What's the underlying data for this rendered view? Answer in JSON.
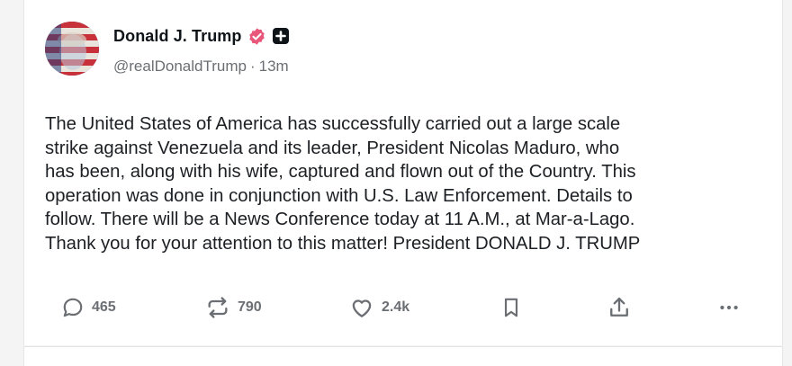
{
  "post": {
    "author_name": "Donald J. Trump",
    "handle": "@realDonaldTrump",
    "separator": "·",
    "time_ago": "13m",
    "text": "The United States of America has successfully carried out a large scale\nstrike against Venezuela and its leader, President Nicolas Maduro, who\nhas been, along with his wife, captured and flown out of the Country. This\noperation was done in conjunction with U.S. Law Enforcement. Details to\nfollow. There will be a News Conference today at 11 A.M., at Mar-a-Lago.\nThank you for your attention to this matter! President DONALD J. TRUMP"
  },
  "actions": {
    "replies": "465",
    "retruths": "790",
    "likes": "2.4k"
  },
  "icons": {
    "verified": "verified-badge-icon",
    "plus": "plus-box-icon",
    "reply": "speech-bubble-icon",
    "retruth": "repost-arrows-icon",
    "like": "heart-icon",
    "bookmark": "bookmark-icon",
    "share": "share-upload-icon",
    "more": "more-dots-icon"
  },
  "colors": {
    "verified": "#e8577a",
    "text": "#1c1f23",
    "muted": "#6b6f73",
    "icon": "#6b6f73"
  }
}
